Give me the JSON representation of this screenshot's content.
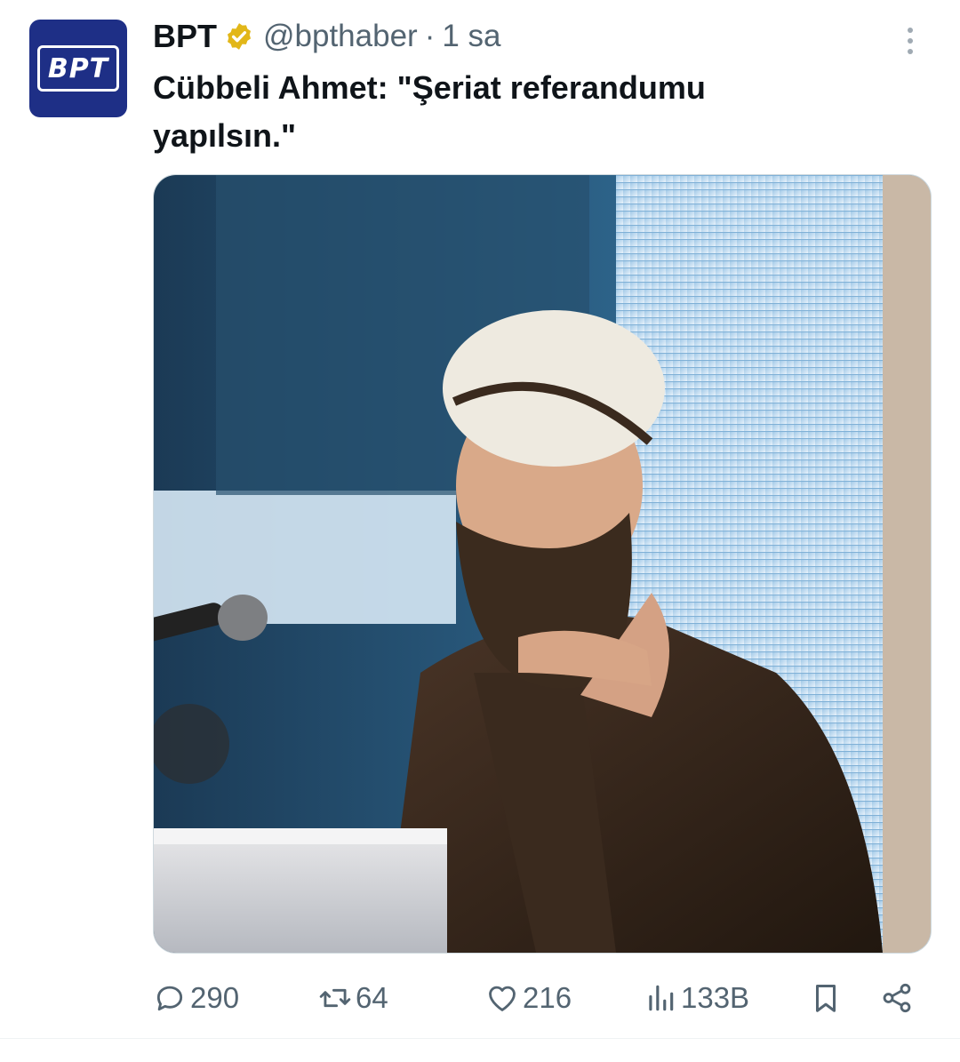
{
  "tweet": {
    "avatar": {
      "logo_text": "BPT",
      "bg_color": "#1e2f86"
    },
    "author": {
      "display_name": "BPT",
      "handle": "@bpthaber",
      "separator": "·",
      "time": "1 sa",
      "verified_badge": "gold-verified-icon"
    },
    "text_line1": "Cübbeli Ahmet: \"Şeriat referandumu",
    "text_line2": "yapılsın.\"",
    "media": {
      "icon": "photo"
    },
    "actions": {
      "replies": "290",
      "retweets": "64",
      "likes": "216",
      "views": "133B"
    },
    "icons": {
      "reply": "reply-icon",
      "retweet": "retweet-icon",
      "like": "heart-icon",
      "views": "views-icon",
      "bookmark": "bookmark-icon",
      "share": "share-icon",
      "more": "more-icon"
    },
    "colors": {
      "text": "#0f1419",
      "secondary": "#536471",
      "verified": "#e2b719"
    }
  }
}
